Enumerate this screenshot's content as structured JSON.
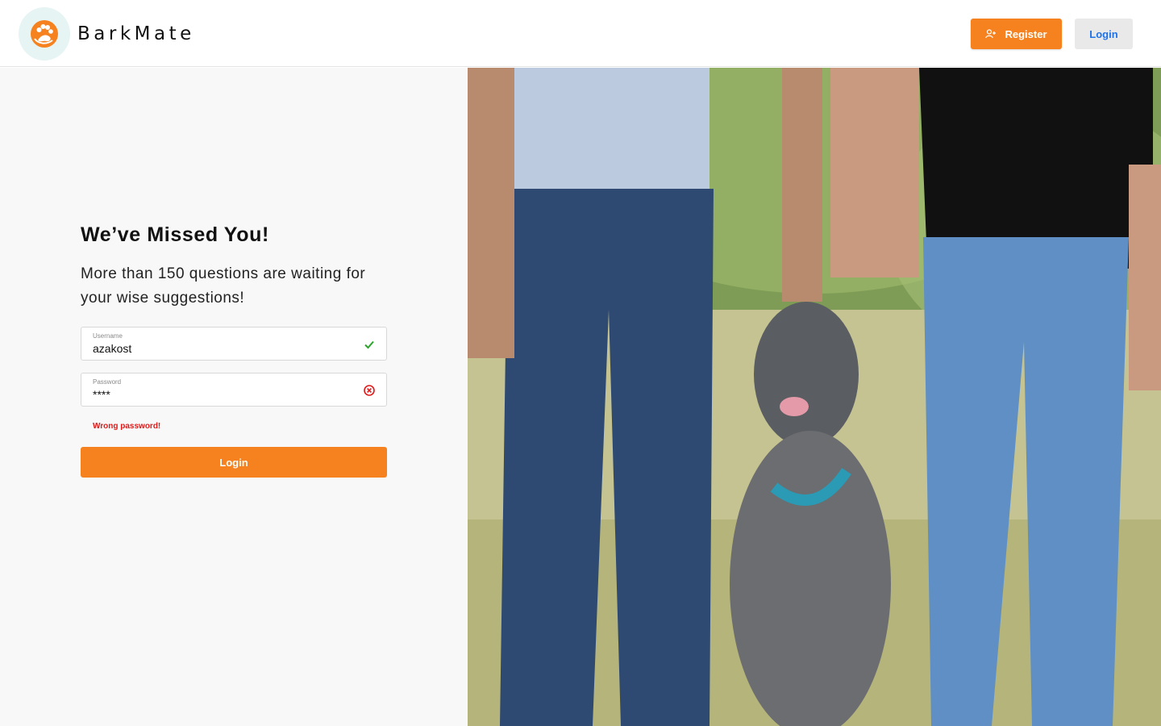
{
  "header": {
    "brand": "BarkMate",
    "register_label": "Register",
    "login_label": "Login"
  },
  "main": {
    "title": "We’ve Missed You!",
    "subtitle": "More than 150 questions are waiting for your wise suggestions!",
    "username": {
      "label": "Username",
      "value": "azakost",
      "status_icon": "check-icon"
    },
    "password": {
      "label": "Password",
      "value": "****",
      "status_icon": "error-circle-icon"
    },
    "error_message": "Wrong password!",
    "login_button": "Login"
  },
  "photo": {
    "description_icon": "dog-with-people-photo"
  },
  "colors": {
    "accent": "#f5821f",
    "link_blue": "#1e73e8",
    "error": "#e01919",
    "success": "#2aa52a",
    "logo_bg": "#e6f4f4"
  }
}
